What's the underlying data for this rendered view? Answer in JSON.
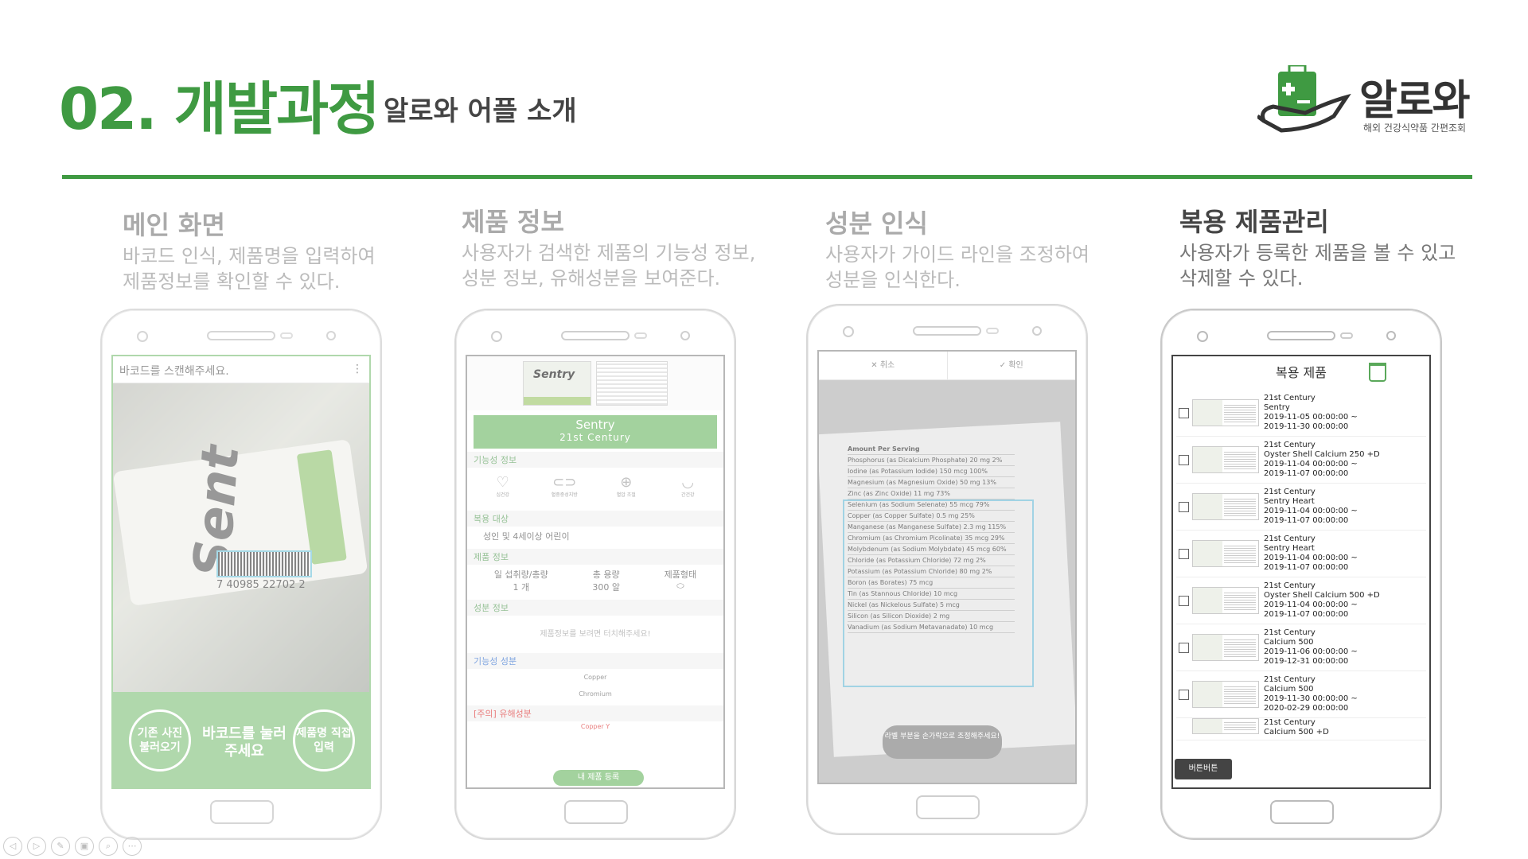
{
  "header": {
    "title": "02. 개발과정",
    "subtitle": "알로와 어플 소개"
  },
  "logo": {
    "name": "알로와",
    "tagline": "해외 건강식약품 간편조회"
  },
  "sections": [
    {
      "title": "메인 화면",
      "desc1": "바코드 인식, 제품명을 입력하여",
      "desc2": "제품정보를 확인할 수 있다."
    },
    {
      "title": "제품 정보",
      "desc1": "사용자가 검색한 제품의 기능성 정보,",
      "desc2": "성분 정보, 유해성분을 보여준다."
    },
    {
      "title": "성분 인식",
      "desc1": "사용자가 가이드 라인을 조정하여",
      "desc2": "성분을 인식한다."
    },
    {
      "title": "복용 제품관리",
      "desc1": "사용자가 등록한 제품을 볼 수 있고",
      "desc2": "삭제할 수 있다."
    }
  ],
  "phone1": {
    "search_text": "바코드를 스캔해주세요.",
    "menu": "⋮",
    "bottle_text": "Sent",
    "barcode_number": "7 40985 22702 2",
    "btn_gallery": "기존 사진 불러오기",
    "btn_scan": "바코드를 눌러주세요",
    "btn_manual": "제품명 직접입력"
  },
  "phone2": {
    "product_name": "Sentry",
    "brand": "21st Century",
    "box_text": "Sentry",
    "sec_function": "기능성 정보",
    "icons": [
      {
        "glyph": "♡",
        "label": "심건강"
      },
      {
        "glyph": "⊂⊃",
        "label": "혈중중성지방"
      },
      {
        "glyph": "⊕",
        "label": "혈압 조절"
      },
      {
        "glyph": "◡",
        "label": "간건강"
      }
    ],
    "sec_target": "복용 대상",
    "target": "성인 및 4세이상 어린이",
    "sec_info": "제품 정보",
    "info": [
      {
        "label": "일 섭취량/총량",
        "value": "1 개"
      },
      {
        "label": "총 용량",
        "value": "300 알"
      },
      {
        "label": "제품형태",
        "value": "⬭"
      }
    ],
    "sec_ingredient": "성분 정보",
    "ingredient_hint": "제품정보를 보려면 터치해주세요!",
    "sec_functional": "기능성 성분",
    "functional": [
      "Copper",
      "Chromium"
    ],
    "sec_harmful": "[주의] 유해성분",
    "harmful": "Copper Y",
    "register_btn": "내 제품 등록"
  },
  "phone3": {
    "cancel": "✕  취소",
    "confirm": "✓  확인",
    "label_header": "Amount Per Serving",
    "rows": [
      "Phosphorus (as Dicalcium Phosphate) 20 mg 2%",
      "Iodine (as Potassium Iodide) 150 mcg 100%",
      "Magnesium (as Magnesium Oxide) 50 mg 13%",
      "Zinc (as Zinc Oxide) 11 mg 73%",
      "Selenium (as Sodium Selenate) 55 mcg 79%",
      "Copper (as Copper Sulfate) 0.5 mg 25%",
      "Manganese (as Manganese Sulfate) 2.3 mg 115%",
      "Chromium (as Chromium Picolinate) 35 mcg 29%",
      "Molybdenum (as Sodium Molybdate) 45 mcg 60%",
      "Chloride (as Potassium Chloride) 72 mg 2%",
      "Potassium (as Potassium Chloride) 80 mg 2%",
      "Boron (as Borates) 75 mcg",
      "Tin (as Stannous Chloride) 10 mcg",
      "Nickel (as Nickelous Sulfate) 5 mcg",
      "Silicon (as Silicon Dioxide) 2 mg",
      "Vanadium (as Sodium Metavanadate) 10 mcg"
    ],
    "toast": "라벨 부분을 손가락으로 조정해주세요!"
  },
  "phone4": {
    "title": "복용 제품",
    "items": [
      {
        "brand": "21st Century",
        "name": "Sentry",
        "start": "2019-11-05 00:00:00 ~",
        "end": "2019-11-30 00:00:00"
      },
      {
        "brand": "21st Century",
        "name": "Oyster Shell Calcium 250 +D",
        "start": "2019-11-04 00:00:00 ~",
        "end": "2019-11-07 00:00:00"
      },
      {
        "brand": "21st Century",
        "name": "Sentry Heart",
        "start": "2019-11-04 00:00:00 ~",
        "end": "2019-11-07 00:00:00"
      },
      {
        "brand": "21st Century",
        "name": "Sentry Heart",
        "start": "2019-11-04 00:00:00 ~",
        "end": "2019-11-07 00:00:00"
      },
      {
        "brand": "21st Century",
        "name": "Oyster Shell Calcium 500 +D",
        "start": "2019-11-04 00:00:00 ~",
        "end": "2019-11-07 00:00:00"
      },
      {
        "brand": "21st Century",
        "name": "Calcium 500",
        "start": "2019-11-06 00:00:00 ~",
        "end": "2019-12-31 00:00:00"
      },
      {
        "brand": "21st Century",
        "name": "Calcium 500",
        "start": "2019-11-30 00:00:00 ~",
        "end": "2020-02-29 00:00:00"
      },
      {
        "brand": "21st Century",
        "name": "Calcium 500 +D",
        "start": "",
        "end": ""
      }
    ],
    "bottom_btn": "버튼버튼"
  },
  "colors": {
    "accent": "#3f9a42",
    "app_green": "#7dbf76",
    "warning": "#e04848"
  },
  "slideshow_icons": [
    "◁",
    "▷",
    "✎",
    "▣",
    "⌕",
    "⋯"
  ]
}
